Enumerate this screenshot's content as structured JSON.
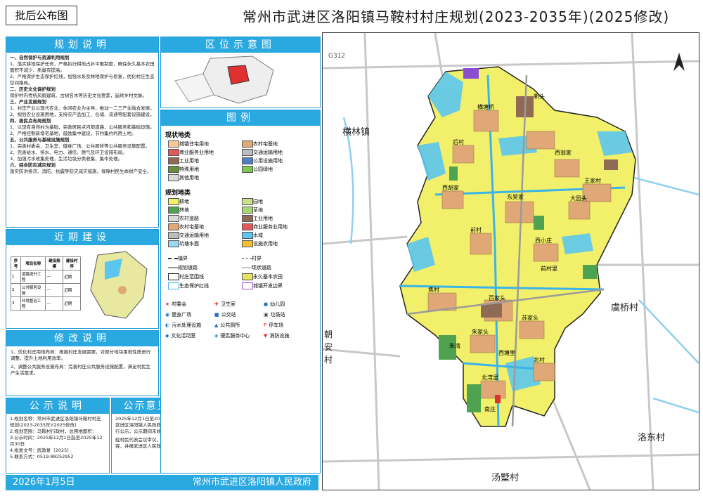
{
  "title": "常州市武进区洛阳镇马鞍村村庄规划(2023-2035年)(2025修改)",
  "badge": "批后公布图",
  "panels": {
    "location": "区位示意图",
    "legend": "图例",
    "planning": "规划说明",
    "nearterm": "近期建设",
    "revision": "修改说明",
    "notice": "公示说明",
    "feedback": "公示意见及反馈"
  },
  "legend": {
    "status_head": "现状地类",
    "plan_head": "规划地类",
    "status_items": [
      "城镇住宅用地",
      "农村宅基地",
      "商业服务业用地",
      "交通运输用地",
      "工业用地",
      "公用设施用地",
      "特殊用地",
      "公园绿地",
      "其他用地"
    ],
    "plan_items": [
      "耕地",
      "园地",
      "林地",
      "草地",
      "农村道路",
      "工业用地",
      "农村宅基地",
      "商业服务业用地",
      "交通运输用地",
      "水域",
      "坑塘水面",
      "设施农用地"
    ],
    "line_items": [
      "镇界",
      "村界",
      "规划道路",
      "现状道路",
      "村庄范围线",
      "永久基本农田",
      "生态保护红线",
      "城镇开发边界"
    ],
    "symbol_items": [
      "村委会",
      "卫生室",
      "幼儿园",
      "健身广场",
      "公交站",
      "垃圾站",
      "污水处理设施",
      "公共厕所",
      "停车场",
      "文化活动室",
      "便民服务中心",
      "消防设施"
    ]
  },
  "planning_text": [
    "一、自然保护与资源利用规划",
    "1、落实耕地保护任务，严格执行耕地占补平衡制度，确保永久基本农田面积不减少、质量有提高。",
    "2、严格保护生态保护红线，加强水系及林地保护与修复，优化村庄生态空间格局。",
    "二、历史文化保护规划",
    "保护村内传统风貌建筑、古树名木等历史文化要素，延续乡村文脉。",
    "三、产业发展规划",
    "1、村庄产业以现代农业、休闲农业为主导，推动一二三产业融合发展。",
    "2、规划农业设施用地，支持农产品加工、仓储、流通等配套设施建设。",
    "四、居民点布局规划",
    "1、以现有自然村为基础，完善居民点内部道路、公共服务和基础设施。",
    "2、严格控制新增宅基地，鼓励集中建设，节约集约利用土地。",
    "五、公共服务与基础设施规划",
    "1、完善村委会、卫生室、健身广场、公共厕所等公共服务设施配置。",
    "2、完善给水、排水、电力、通信、燃气及环卫设施布局。",
    "3、加强污水收集处理，生活垃圾分类收集、集中处理。",
    "六、综合防灾减灾规划",
    "落实防洪排涝、消防、抗震等防灾减灾措施，保障村民生命财产安全。"
  ],
  "nearterm_table": {
    "headers": [
      "序号",
      "项目名称",
      "建设规模",
      "建设时序"
    ],
    "rows": [
      [
        "1",
        "道路提升工程",
        "—",
        "近期"
      ],
      [
        "2",
        "公共服务设施",
        "—",
        "近期"
      ],
      [
        "3",
        "环境整治工程",
        "—",
        "近期"
      ]
    ]
  },
  "revision_text": [
    "1、优化村庄用地布局：根据村庄发展需要，对部分地块用地性质进行调整，提升土地利用效率。",
    "2、调整公共服务设施布局：完善村庄公共服务设施配置，满足村民生产生活需求。"
  ],
  "notice_text": [
    "1.规划名称：常州市武进区洛阳镇马鞍村村庄规划(2023-2035年)(2025修改)",
    "2.规划范围：马鞍村行政村，总用地面积：",
    "3.公示时间：2025年12月1日起至2025年12月30日",
    "4.批复文号：武政复〔2025〕",
    "5.联系方式：0519-88252952"
  ],
  "feedback_text": [
    "2025年12月1日至2025年12月30日在常州市武进区洛阳镇人民政府网站、马鞍村公示栏进行公示，公示期间未收到相关意见。",
    "经村民代表会议审议，同意本次规划修改内容，并报武进区人民政府批准。"
  ],
  "footer": {
    "org": "常州市武进区洛阳镇人民政府",
    "date": "2026年1月5日"
  },
  "map_labels": {
    "road_g": "G312",
    "town_henglin": "横林镇",
    "village_yuqiao": "虞桥村",
    "village_luodong": "洛东村",
    "village_tangxi": "汤墅村",
    "village_chaoan": "朝安村",
    "villages": [
      "横塘桥",
      "西翁家",
      "后村",
      "王家村",
      "西胡家",
      "东吴家",
      "西小庄",
      "前村",
      "大园头",
      "焦村",
      "百家头",
      "苏家头",
      "朱家头",
      "北村",
      "北湾里",
      "新头",
      "朱湾",
      "前村里",
      "西塘里",
      "南庄"
    ]
  },
  "colors": {
    "accent": "#2aa8e0",
    "farmland": "#f2f06a",
    "residential": "#e0a877",
    "water": "#5cc6ee",
    "forest": "#4fa24f",
    "industrial": "#8f6a55",
    "commercial": "#e05a5a"
  }
}
